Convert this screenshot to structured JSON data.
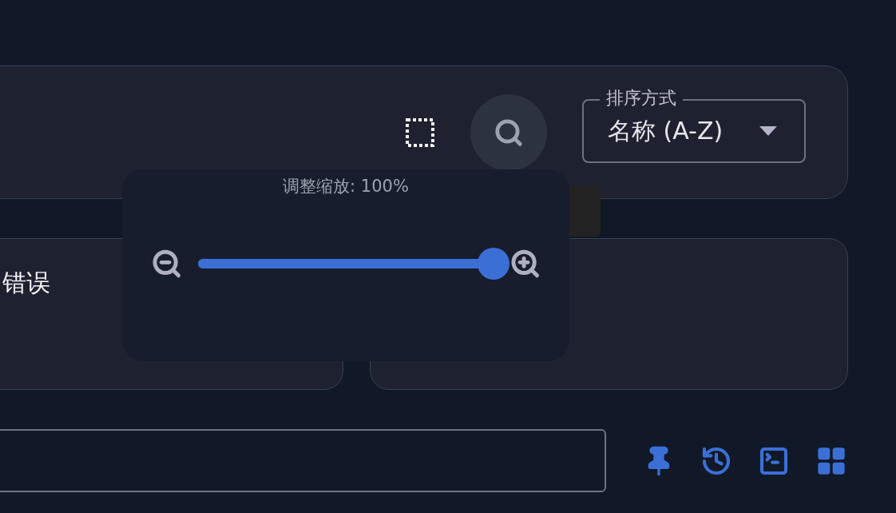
{
  "toolbar": {
    "sort": {
      "label": "排序方式",
      "value": "名称 (A-Z)"
    }
  },
  "zoom_popup": {
    "title": "调整缩放: 100%",
    "level": 1
  },
  "cards": [
    {
      "title": "错误"
    }
  ]
}
